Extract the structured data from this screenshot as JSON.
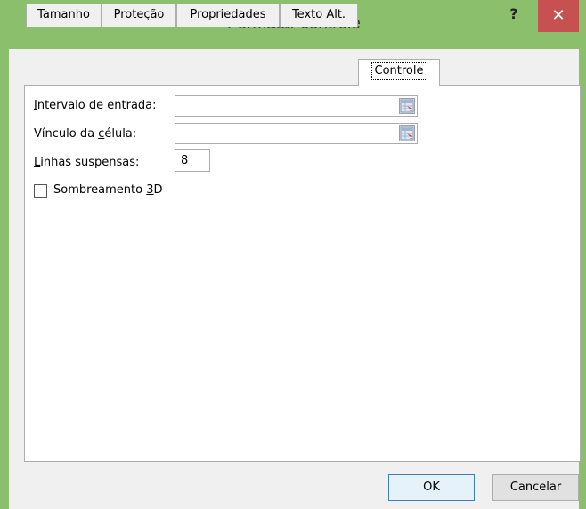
{
  "window": {
    "title": "Formatar controle",
    "help": "?",
    "close": "✕"
  },
  "tabs": [
    {
      "label": "Tamanho"
    },
    {
      "label": "Proteção"
    },
    {
      "label": "Propriedades"
    },
    {
      "label": "Texto Alt."
    },
    {
      "label": "Controle",
      "active": true
    }
  ],
  "form": {
    "input_range_label_pre": "",
    "input_range_label_ul": "I",
    "input_range_label_post": "ntervalo de entrada:",
    "input_range_value": "",
    "cell_link_label_pre": "Vínculo da ",
    "cell_link_label_ul": "c",
    "cell_link_label_post": "élula:",
    "cell_link_value": "",
    "dropdown_lines_label_pre": "",
    "dropdown_lines_label_ul": "L",
    "dropdown_lines_label_post": "inhas suspensas:",
    "dropdown_lines_value": "8",
    "shading_label_pre": "Sombreamento ",
    "shading_label_ul": "3",
    "shading_label_post": "D",
    "shading_checked": false
  },
  "buttons": {
    "ok": "OK",
    "cancel": "Cancelar"
  },
  "colors": {
    "accent_border": "#8cbf6b",
    "close_button": "#c75050"
  }
}
